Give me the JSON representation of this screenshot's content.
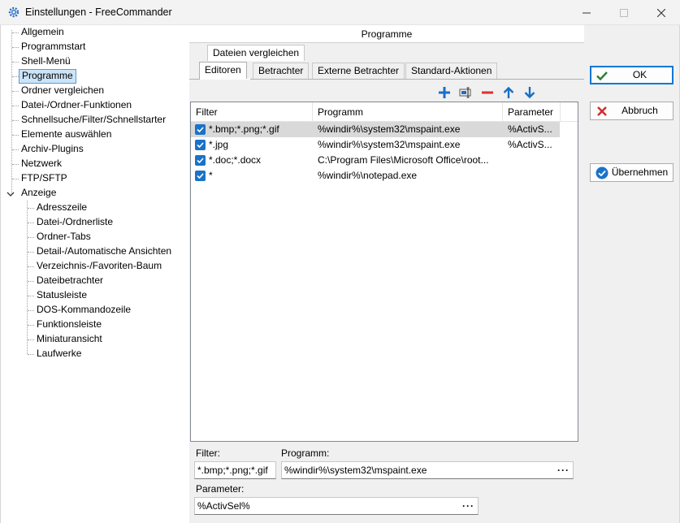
{
  "window": {
    "title": "Einstellungen - FreeCommander",
    "app_icon": "gear-icon"
  },
  "tree": {
    "items": [
      {
        "label": "Allgemein"
      },
      {
        "label": "Programmstart"
      },
      {
        "label": "Shell-Menü"
      },
      {
        "label": "Programme",
        "selected": true
      },
      {
        "label": "Ordner vergleichen"
      },
      {
        "label": "Datei-/Ordner-Funktionen"
      },
      {
        "label": "Schnellsuche/Filter/Schnellstarter"
      },
      {
        "label": "Elemente auswählen"
      },
      {
        "label": "Archiv-Plugins"
      },
      {
        "label": "Netzwerk"
      },
      {
        "label": "FTP/SFTP"
      },
      {
        "label": "Anzeige",
        "expanded": true
      }
    ],
    "anzeige_children": [
      {
        "label": "Adresszeile"
      },
      {
        "label": "Datei-/Ordnerliste"
      },
      {
        "label": "Ordner-Tabs"
      },
      {
        "label": "Detail-/Automatische Ansichten"
      },
      {
        "label": "Verzeichnis-/Favoriten-Baum"
      },
      {
        "label": "Dateibetrachter"
      },
      {
        "label": "Statusleiste"
      },
      {
        "label": "DOS-Kommandozeile"
      },
      {
        "label": "Funktionsleiste"
      },
      {
        "label": "Miniaturansicht"
      },
      {
        "label": "Laufwerke"
      }
    ]
  },
  "panel": {
    "header": "Programme",
    "tabs_top": [
      {
        "label": "Dateien vergleichen"
      }
    ],
    "tabs": [
      {
        "label": "Editoren",
        "active": true
      },
      {
        "label": "Betrachter"
      },
      {
        "label": "Externe Betrachter"
      },
      {
        "label": "Standard-Aktionen"
      }
    ],
    "toolbar": [
      "plus-icon",
      "edit-icon",
      "minus-icon",
      "arrow-up-icon",
      "arrow-down-icon"
    ],
    "columns": [
      "Filter",
      "Programm",
      "Parameter"
    ],
    "rows": [
      {
        "checked": true,
        "filter": "*.bmp;*.png;*.gif",
        "program": "%windir%\\system32\\mspaint.exe",
        "param": "%ActivS...",
        "selected": true
      },
      {
        "checked": true,
        "filter": "*.jpg",
        "program": "%windir%\\system32\\mspaint.exe",
        "param": "%ActivS..."
      },
      {
        "checked": true,
        "filter": "*.doc;*.docx",
        "program": "C:\\Program Files\\Microsoft Office\\root...",
        "param": ""
      },
      {
        "checked": true,
        "filter": "*",
        "program": "%windir%\\notepad.exe",
        "param": ""
      }
    ],
    "editor": {
      "filter_label": "Filter:",
      "filter_value": "*.bmp;*.png;*.gif",
      "program_label": "Programm:",
      "program_value": "%windir%\\system32\\mspaint.exe",
      "parameter_label": "Parameter:",
      "parameter_value": "%ActivSel%",
      "browse_glyph": "···"
    }
  },
  "buttons": {
    "ok": {
      "label": "OK",
      "icon": "check-icon",
      "color": "#2e7d32"
    },
    "cancel": {
      "label": "Abbruch",
      "icon": "close-icon",
      "color": "#d32f2f"
    },
    "apply": {
      "label": "Übernehmen",
      "icon": "check-circle-icon",
      "color": "#1a73c8"
    }
  },
  "colors": {
    "accent": "#0078d4",
    "selection": "#cce4f7",
    "checkbox": "#1a73c8"
  }
}
